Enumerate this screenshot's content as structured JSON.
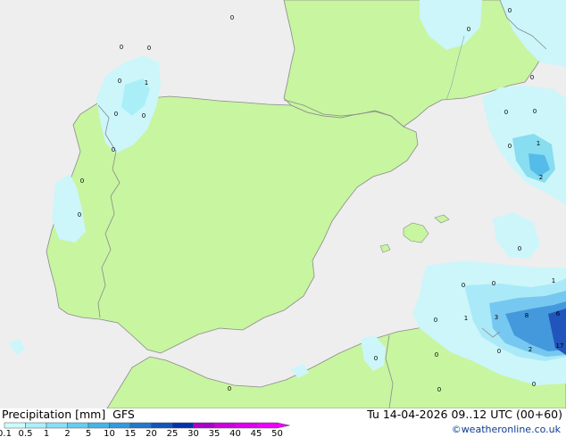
{
  "footer": {
    "title": "Precipitation [mm]",
    "model": "GFS",
    "valid": "Tu 14-04-2026 09..12 UTC (00+60)",
    "credit": "©weatheronline.co.uk"
  },
  "legend": {
    "labels": [
      "0.1",
      "0.5",
      "1",
      "2",
      "5",
      "10",
      "15",
      "20",
      "25",
      "30",
      "35",
      "40",
      "45",
      "50"
    ],
    "colors": [
      "#ccffff",
      "#aaf0ff",
      "#88e0f8",
      "#66ccf0",
      "#44b4e8",
      "#3399dd",
      "#2277cc",
      "#1155bb",
      "#0033aa",
      "#aa00cc",
      "#cc00dd",
      "#dd00ee",
      "#ee00ff"
    ]
  },
  "map": {
    "colors": {
      "sea": "#eeeeee",
      "land": "#c8f5a0",
      "border": "#8a8a8a",
      "precip_light": "#ccf6fa"
    },
    "values": [
      {
        "id": "v1",
        "text": "0"
      },
      {
        "id": "v2",
        "text": "0"
      },
      {
        "id": "v3",
        "text": "0"
      },
      {
        "id": "v4",
        "text": "0"
      },
      {
        "id": "v5",
        "text": "0"
      },
      {
        "id": "v6",
        "text": "1"
      },
      {
        "id": "v7",
        "text": "0"
      },
      {
        "id": "v8",
        "text": "0"
      },
      {
        "id": "v9",
        "text": "0"
      },
      {
        "id": "v10",
        "text": "0"
      },
      {
        "id": "v11",
        "text": "0"
      },
      {
        "id": "v12",
        "text": "0"
      },
      {
        "id": "v13",
        "text": "0"
      },
      {
        "id": "v14",
        "text": "0"
      },
      {
        "id": "v15",
        "text": "0"
      },
      {
        "id": "v16",
        "text": "0"
      },
      {
        "id": "v17",
        "text": "1"
      },
      {
        "id": "v18",
        "text": "2"
      },
      {
        "id": "v19",
        "text": "0"
      },
      {
        "id": "v20",
        "text": "1"
      },
      {
        "id": "v21",
        "text": "0"
      },
      {
        "id": "v22",
        "text": "0"
      },
      {
        "id": "v23",
        "text": "0"
      },
      {
        "id": "v24",
        "text": "1"
      },
      {
        "id": "v25",
        "text": "3"
      },
      {
        "id": "v26",
        "text": "8"
      },
      {
        "id": "v27",
        "text": "6"
      },
      {
        "id": "v28",
        "text": "0"
      },
      {
        "id": "v29",
        "text": "0"
      },
      {
        "id": "v30",
        "text": "2"
      },
      {
        "id": "v31",
        "text": "17"
      },
      {
        "id": "v32",
        "text": "0"
      },
      {
        "id": "v33",
        "text": "0"
      },
      {
        "id": "v34",
        "text": "0"
      },
      {
        "id": "v35",
        "text": "0"
      }
    ]
  }
}
